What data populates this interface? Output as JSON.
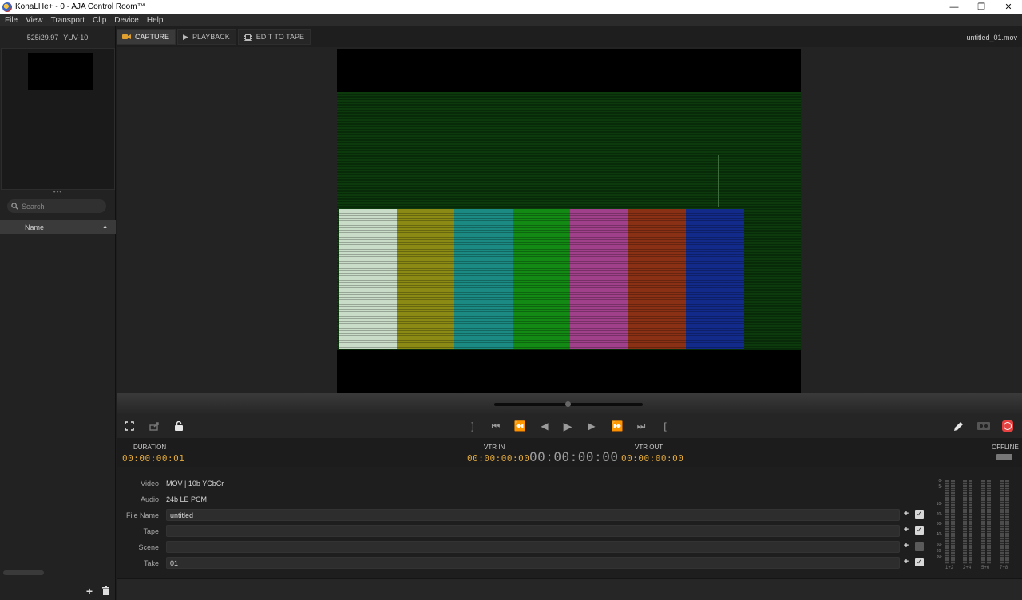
{
  "window": {
    "title": "KonaLHe+ - 0 - AJA Control Room™"
  },
  "menu": [
    "File",
    "View",
    "Transport",
    "Clip",
    "Device",
    "Help"
  ],
  "format": {
    "standard": "525i29.97",
    "pixel": "YUV-10"
  },
  "search": {
    "placeholder": "Search"
  },
  "list": {
    "column": "Name"
  },
  "tabs": [
    {
      "label": "CAPTURE",
      "icon": "camera-icon",
      "active": true
    },
    {
      "label": "PLAYBACK",
      "icon": "play-icon",
      "active": false
    },
    {
      "label": "EDIT TO TAPE",
      "icon": "film-icon",
      "active": false
    }
  ],
  "filename": "untitled_01.mov",
  "colorbars": [
    "#c8dcc8",
    "#8a8a14",
    "#1a8a82",
    "#138a13",
    "#a0408a",
    "#8a3014",
    "#122a8a"
  ],
  "timecodes": {
    "duration_label": "DURATION",
    "duration": "00:00:00:01",
    "vtr_in_label": "VTR IN",
    "vtr_in": "00:00:00:00",
    "current": "00:00:00:00",
    "vtr_out_label": "VTR OUT",
    "vtr_out": "00:00:00:00",
    "status": "OFFLINE"
  },
  "metadata": {
    "video_label": "Video",
    "video": "MOV | 10b YCbCr",
    "audio_label": "Audio",
    "audio": "24b LE PCM",
    "file_name_label": "File Name",
    "file_name": "untitled",
    "tape_label": "Tape",
    "tape": "",
    "scene_label": "Scene",
    "scene": "",
    "take_label": "Take",
    "take": "01"
  },
  "meters": {
    "scale": [
      "0-",
      "5-",
      "10-",
      "20-",
      "30-",
      "40-",
      "50-",
      "60-",
      "80-"
    ],
    "channels": [
      "1+2",
      "2+4",
      "5+6",
      "7+8"
    ]
  }
}
